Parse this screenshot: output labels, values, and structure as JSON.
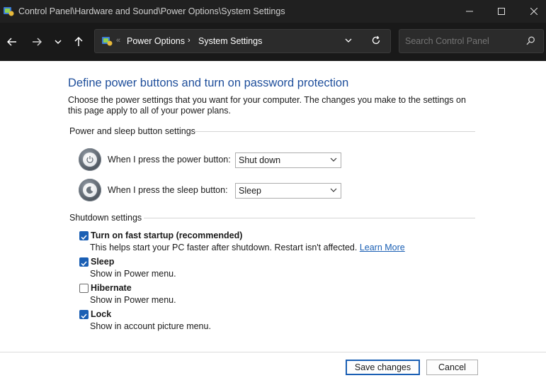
{
  "window": {
    "title": "Control Panel\\Hardware and Sound\\Power Options\\System Settings"
  },
  "nav": {
    "breadcrumb_sep": "«",
    "crumb_arrow": "›",
    "crumbs": [
      "Power Options",
      "System Settings"
    ]
  },
  "search": {
    "placeholder": "Search Control Panel"
  },
  "page": {
    "heading": "Define power buttons and turn on password protection",
    "description": "Choose the power settings that you want for your computer. The changes you make to the settings on this page apply to all of your power plans."
  },
  "power_section": {
    "title": "Power and sleep button settings",
    "rows": [
      {
        "label": "When I press the power button:",
        "value": "Shut down"
      },
      {
        "label": "When I press the sleep button:",
        "value": "Sleep"
      }
    ]
  },
  "shutdown_section": {
    "title": "Shutdown settings",
    "items": [
      {
        "label": "Turn on fast startup (recommended)",
        "description": "This helps start your PC faster after shutdown. Restart isn't affected.",
        "link": "Learn More",
        "checked": true
      },
      {
        "label": "Sleep",
        "description": "Show in Power menu.",
        "checked": true
      },
      {
        "label": "Hibernate",
        "description": "Show in Power menu.",
        "checked": false
      },
      {
        "label": "Lock",
        "description": "Show in account picture menu.",
        "checked": true
      }
    ]
  },
  "footer": {
    "save_label": "Save changes",
    "cancel_label": "Cancel"
  },
  "colors": {
    "heading": "#1e4e9b",
    "link": "#1a5fb4",
    "checkbox": "#1a5fb4",
    "titlebar": "#202020",
    "navbar": "#191919"
  }
}
